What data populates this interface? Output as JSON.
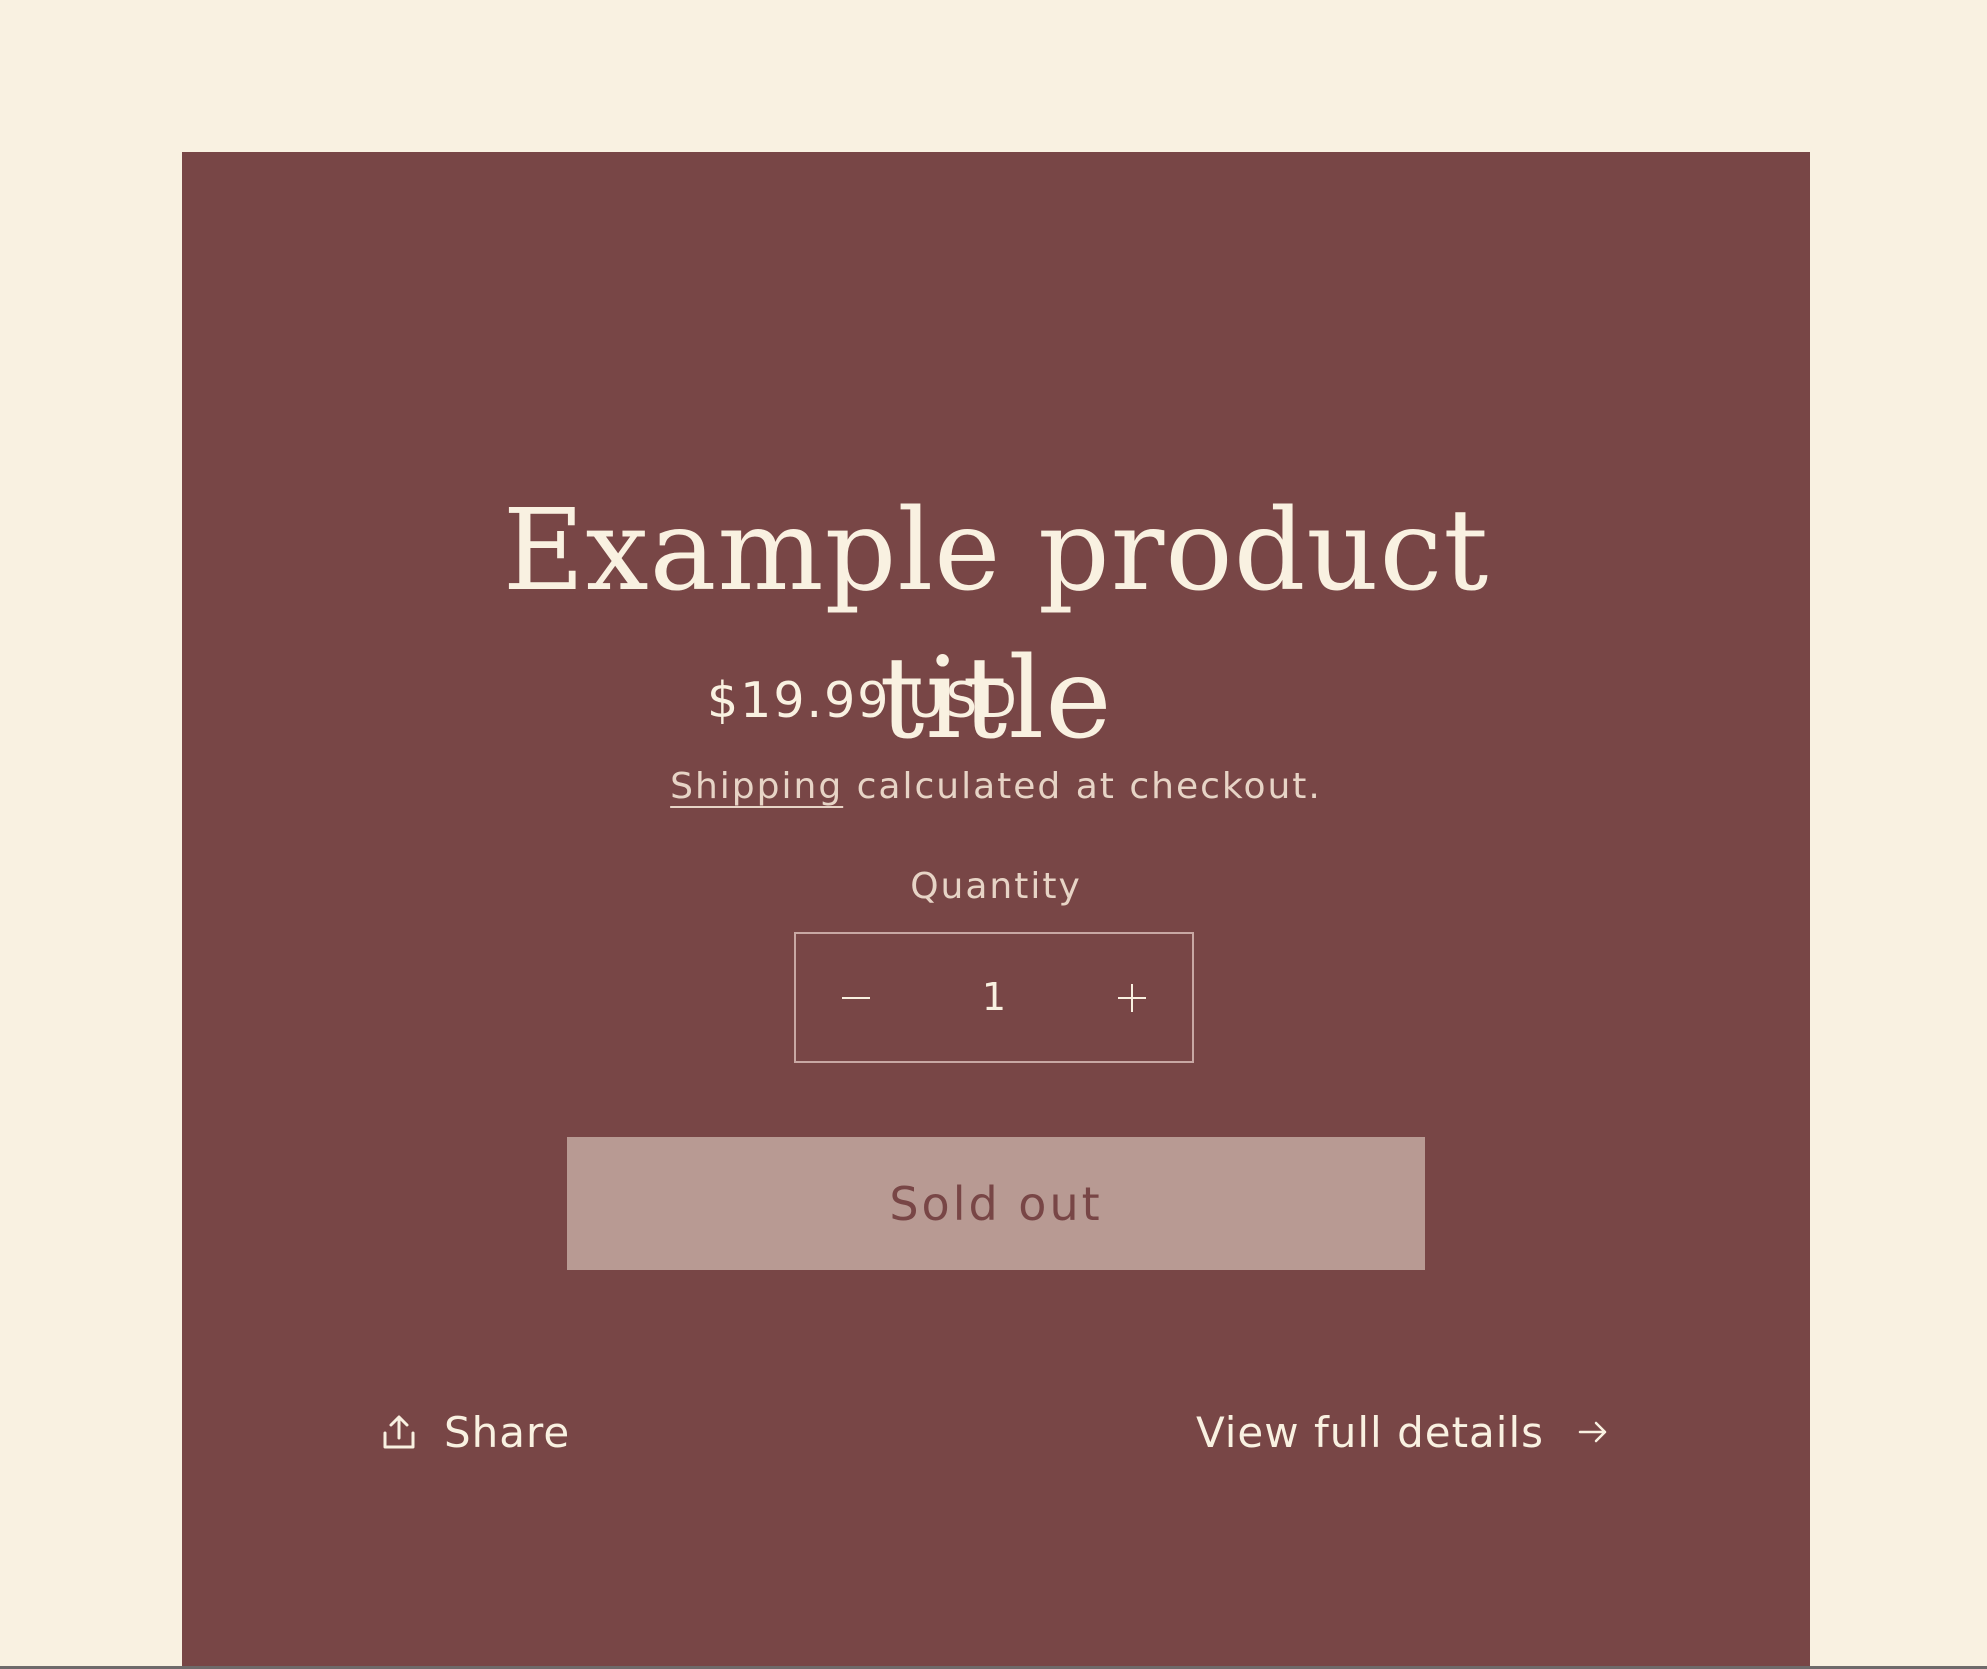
{
  "product": {
    "title_line1": "Example product",
    "title_line2": "title",
    "price": "$19.99 USD",
    "shipping_link": "Shipping",
    "shipping_rest": " calculated at checkout.",
    "quantity_label": "Quantity",
    "quantity_value": "1",
    "sold_out_label": "Sold out"
  },
  "footer": {
    "share_label": "Share",
    "details_label": "View full details"
  },
  "icons": {
    "share": "share-upload-icon",
    "minus": "minus-icon",
    "plus": "plus-icon",
    "arrow": "arrow-right-icon"
  },
  "colors": {
    "page_background": "#f9f1e1",
    "card_background": "#784646",
    "text_light": "#f9f1e1",
    "button_disabled": "#b89a93"
  }
}
